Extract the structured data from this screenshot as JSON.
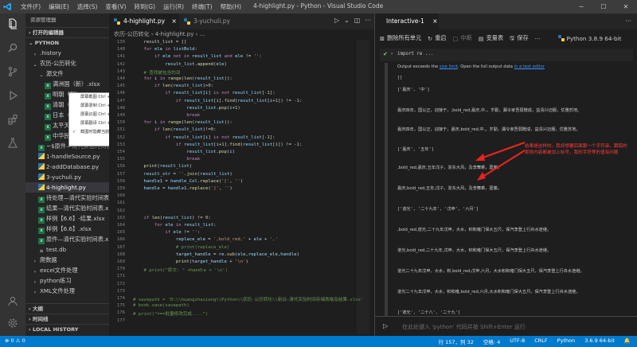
{
  "titlebar": {
    "menu": [
      "文件(F)",
      "编辑(E)",
      "选择(S)",
      "查看(V)",
      "转到(G)",
      "运行(R)",
      "终端(T)",
      "帮助(H)"
    ],
    "title": "4-highlight.py - Python - Visual Studio Code"
  },
  "sidebar": {
    "header": "资源管理器",
    "open_editors": "打开的编辑器",
    "folder": "PYTHON",
    "items": [
      {
        "label": ".history",
        "indent": 1,
        "icon": "chevron-right",
        "color": "#cccccc"
      },
      {
        "label": "农历-公历转化",
        "indent": 1,
        "icon": "chevron-down",
        "color": "#cccccc"
      },
      {
        "label": "源文件",
        "indent": 2,
        "icon": "chevron-down",
        "color": "#cccccc"
      },
      {
        "label": "满洲国（新）.xlsx",
        "indent": 3,
        "icon": "excel",
        "color": "#cccccc"
      },
      {
        "label": "明朝（新）.xlsx",
        "indent": 3,
        "icon": "excel",
        "color": "#cccccc"
      },
      {
        "label": "清朝（新）.xlsx",
        "indent": 3,
        "icon": "excel",
        "color": "#cccccc"
      },
      {
        "label": "日本（新）.xlsx",
        "indent": 3,
        "icon": "excel",
        "color": "#cccccc"
      },
      {
        "label": "太平天国（新）.xlsx",
        "indent": 3,
        "icon": "excel",
        "color": "#cccccc"
      },
      {
        "label": "中华民国（新）.xlsx",
        "indent": 3,
        "icon": "excel",
        "color": "#cccccc"
      },
      {
        "label": "~$原件—清代实验时间表.xlsx",
        "indent": 2,
        "icon": "excel",
        "color": "#cccccc"
      },
      {
        "label": "1-handleSource.py",
        "indent": 2,
        "icon": "python",
        "color": "#cccccc"
      },
      {
        "label": "2-addDatabase.py",
        "indent": 2,
        "icon": "python",
        "color": "#cccccc"
      },
      {
        "label": "3-yuchuli.py",
        "indent": 2,
        "icon": "python",
        "color": "#cccccc"
      },
      {
        "label": "4-highlight.py",
        "indent": 2,
        "icon": "python",
        "color": "#ffffff",
        "selected": true
      },
      {
        "label": "待处理—清代实验时间表.xlsx",
        "indent": 2,
        "icon": "excel",
        "color": "#cccccc"
      },
      {
        "label": "结果—清代实验时间表.xlsx",
        "indent": 2,
        "icon": "excel",
        "color": "#cccccc"
      },
      {
        "label": "样例【6.6】-结果.xlsx",
        "indent": 2,
        "icon": "excel",
        "color": "#cccccc"
      },
      {
        "label": "样例【6.6】.xlsx",
        "indent": 2,
        "icon": "excel",
        "color": "#cccccc"
      },
      {
        "label": "原件—清代实验时间表.xlsx",
        "indent": 2,
        "icon": "excel",
        "color": "#cccccc"
      },
      {
        "label": "test.db",
        "indent": 2,
        "icon": "db",
        "color": "#cccccc"
      },
      {
        "label": "爬数据",
        "indent": 1,
        "icon": "chevron-right",
        "color": "#cccccc"
      },
      {
        "label": "excel文件处理",
        "indent": 1,
        "icon": "chevron-right",
        "color": "#cccccc"
      },
      {
        "label": "python练习",
        "indent": 1,
        "icon": "chevron-right",
        "color": "#cccccc"
      },
      {
        "label": "XML文件处理",
        "indent": 1,
        "icon": "chevron-right",
        "color": "#cccccc"
      }
    ],
    "outline": "大纲",
    "timeline": "时间线",
    "local_history": "LOCAL HISTORY"
  },
  "context_menu": {
    "items": [
      {
        "label": "屏幕截图 Ctrl + Alt + A",
        "checked": false
      },
      {
        "label": "屏幕录制 Ctrl + Alt + S",
        "checked": false
      },
      {
        "label": "屏幕识图 Ctrl + Alt + O",
        "checked": false
      },
      {
        "label": "屏幕翻译 Ctrl + Alt + F",
        "checked": false
      },
      {
        "label": "截图时隐藏当前窗口",
        "checked": true
      }
    ]
  },
  "editor": {
    "tabs": [
      {
        "label": "4-highlight.py",
        "active": true,
        "close": "×"
      },
      {
        "label": "3-yuchuli.py",
        "active": false,
        "close": ""
      }
    ],
    "breadcrumb": [
      "农历-公历转化",
      "4-highlight.py",
      "..."
    ],
    "lines": [
      {
        "n": "139",
        "html": "    result_list = []"
      },
      {
        "n": "140",
        "html": "    <span class='k'>for</span> <span class='v'>ele</span> <span class='k'>in</span> <span class='v'>listBold</span>:"
      },
      {
        "n": "141",
        "html": "        <span class='k'>if</span> <span class='v'>ele</span> <span class='k'>not in</span> <span class='v'>result_list</span> <span class='k'>and</span> <span class='v'>ele</span> != <span class='s'>''</span>:"
      },
      {
        "n": "142",
        "html": "            <span class='v'>result_list</span>.<span class='f'>append</span>(<span class='v'>ele</span>)"
      },
      {
        "n": "143",
        "html": "    <span class='c'># 查找被包含的词</span>"
      },
      {
        "n": "144",
        "html": "    <span class='k'>for</span> <span class='v'>i</span> <span class='k'>in</span> <span class='f'>range</span>(<span class='f'>len</span>(<span class='v'>result_list</span>)):"
      },
      {
        "n": "145",
        "html": "        <span class='k'>if</span> <span class='f'>len</span>(<span class='v'>result_list</span>)&gt;<span class='n'>0</span>:"
      },
      {
        "n": "146",
        "html": "            <span class='k'>if</span> <span class='v'>result_list</span>[<span class='v'>i</span>] <span class='k'>is not</span> <span class='v'>result_list</span>[<span class='n'>-1</span>]:"
      },
      {
        "n": "147",
        "html": "                <span class='k'>if</span> <span class='v'>result_list</span>[<span class='v'>i</span>].<span class='f'>find</span>(<span class='v'>result_list</span>[<span class='v'>i</span>+<span class='n'>1</span>]) != <span class='n'>-1</span>:"
      },
      {
        "n": "148",
        "html": "                    <span class='v'>result_list</span>.<span class='f'>pop</span>(<span class='v'>i</span>+<span class='n'>1</span>)"
      },
      {
        "n": "149",
        "html": "                    <span class='k'>break</span>"
      },
      {
        "n": "150",
        "html": "    <span class='k'>for</span> <span class='v'>i</span> <span class='k'>in</span> <span class='f'>range</span>(<span class='f'>len</span>(<span class='v'>result_list</span>)):"
      },
      {
        "n": "151",
        "html": "        <span class='k'>if</span> <span class='f'>len</span>(<span class='v'>result_list</span>)!=<span class='n'>0</span>:"
      },
      {
        "n": "152",
        "html": "            <span class='k'>if</span> <span class='v'>result_list</span>[<span class='v'>i</span>] <span class='k'>is not</span> <span class='v'>result_list</span>[<span class='n'>-1</span>]:"
      },
      {
        "n": "153",
        "html": "                <span class='k'>if</span> <span class='v'>result_list</span>[<span class='v'>i</span>+<span class='n'>1</span>].<span class='f'>find</span>(<span class='v'>result_list</span>[<span class='v'>i</span>]) != <span class='n'>-1</span>:"
      },
      {
        "n": "154",
        "html": "                    <span class='v'>result_list</span>.<span class='f'>pop</span>(<span class='v'>i</span>)"
      },
      {
        "n": "155",
        "html": "                    <span class='k'>break</span>"
      },
      {
        "n": "156",
        "html": "    <span class='f'>print</span>(<span class='v'>result_list</span>)"
      },
      {
        "n": "157",
        "html": "    <span class='v'>result_str</span> = <span class='s'>''</span>.<span class='f'>join</span>(<span class='v'>result_list</span>)"
      },
      {
        "n": "158",
        "html": "    <span class='v'>handle1</span> = <span class='v'>handle_Col</span>.<span class='f'>replace</span>(<span class='s'>'['</span>, <span class='s'>''</span>)"
      },
      {
        "n": "159",
        "html": "    <span class='v'>handle</span> = <span class='v'>handle1</span>.<span class='f'>replace</span>(<span class='s'>']'</span>, <span class='s'>''</span>)"
      },
      {
        "n": "160",
        "html": ""
      },
      {
        "n": "161",
        "html": ""
      },
      {
        "n": "162",
        "html": ""
      },
      {
        "n": "163",
        "html": "    <span class='k'>if</span> <span class='f'>len</span>(<span class='v'>result_list</span>) != <span class='n'>0</span>:"
      },
      {
        "n": "164",
        "html": "        <span class='k'>for</span> <span class='v'>ele</span> <span class='k'>in</span> <span class='v'>result_list</span>:"
      },
      {
        "n": "165",
        "html": "            <span class='k'>if</span> <span class='v'>ele</span> != <span class='s'>''</span>:"
      },
      {
        "n": "166",
        "html": "                <span class='v'>replace_ele</span> = <span class='s'>',bold_red,'</span> + <span class='v'>ele</span> + <span class='s'>','</span>"
      },
      {
        "n": "167",
        "html": "                <span class='c'># print(replace_ele)</span>"
      },
      {
        "n": "168",
        "html": "                <span class='v'>target_handle</span> = <span class='v'>re</span>.<span class='f'>sub</span>(<span class='v'>ele</span>,<span class='v'>replace_ele</span>,<span class='v'>handle</span>)"
      },
      {
        "n": "169",
        "html": "                <span class='f'>print</span>(<span class='v'>target_handle</span> + <span class='s'>'\\n'</span>)"
      },
      {
        "n": "170",
        "html": "    <span class='c'># print(\"原文: \" +handle + '\\n')</span>"
      },
      {
        "n": "171",
        "html": ""
      },
      {
        "n": "172",
        "html": ""
      },
      {
        "n": "173",
        "html": ""
      },
      {
        "n": "174",
        "html": "<span class='c'># savepath = 'D:\\\\huangzhaiiang\\\\Python\\\\农历-公历转化\\\\新议—清代实验时间存储表格及结果.xlsx'</span>"
      },
      {
        "n": "175",
        "html": "<span class='c'># book.save(savepath)</span>"
      },
      {
        "n": "176",
        "html": "<span class='c'># print(\"===批量修改完成....\")</span>"
      },
      {
        "n": "177",
        "html": ""
      }
    ]
  },
  "interactive": {
    "tab": "Interactive-1",
    "toolbar": [
      "删除所有单元",
      "重启",
      "中断",
      "变量表",
      "保存"
    ],
    "kernel": "Python 3.8.9 64-bit",
    "cell_label": "import re ...",
    "output_prefix": "Output exceeds the ",
    "size_limit": "size limit",
    "output_mid": ". Open the full output data ",
    "text_editor": "in a text editor",
    "output_lines": [
      "[]",
      "['嘉庆', '中']",
      "嘉庆四年，国以正，迎接于，,bold_red,嘉庆,中,，岁勤，漏令家吾弱赠成，益清兴迈服，优雅苏地。",
      "嘉庆四年，国以正，迎接于，嘉庆,bold_red,中,，岁勤，漏令家吾弱赠成，益清兴迈服，优雅苏地。",
      "['嘉庆', '五年']",
      ",bold_red,嘉庆,五年戊子，浙东大风，及李舞乘，葛藤。",
      "嘉庆,bold_red,五年,戊子，浙东大风，及李舞乘，葛藤。",
      "['道光', '二十九年', '戊申', '六月']",
      ",bold_red,道光,二十九年戊申，大水，积和雍门保大五尺，保汽李登上行舟水途继。",
      "道光,bold_red,二十九年,戊申，大水，积和雍门保大五尺，保汽李登上行舟水途继。",
      "道光二十九年戊申，大水，积,bold_red,戊申,六月，大水积和雍门保大五尺，保汽李登上行舟水途继。",
      "道光二十九年戊申，大水，积和雍,bold_red,六月,大水积和雍门保大五尺，保汽李登上行舟水途继。",
      "['道光', '二十八', '二十九']"
    ],
    "annotation": "结果是这样的。我却想要后面跟一个字符串，跟踪的那段内容都被加上标号，我的字符等的值有问题",
    "input_placeholder": "在此处键入 'python' 代码并按 Shift+Enter 运行"
  },
  "statusbar": {
    "left": [
      "⊗ 0 ⚠ 0"
    ],
    "right": [
      "行 157，列 32",
      "空格: 4",
      "UTF-8",
      "CRLF",
      "Python",
      "3.6.9 64-bit",
      "🔔"
    ]
  },
  "colors": {
    "accent": "#007acc",
    "annotation": "#ff3b3b",
    "arrow": "#e8231f"
  }
}
